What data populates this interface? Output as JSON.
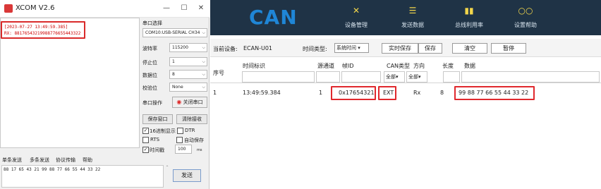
{
  "xcom": {
    "title": "XCOM V2.6",
    "controls": {
      "minimize": "—",
      "maximize": "☐",
      "close": "✕"
    },
    "receive_lines": [
      "[2023-07-27 13:49:59.385]",
      "RX: 88176543219988776655443322"
    ],
    "port_select_label": "串口选择",
    "port_value": "COM10:USB-SERIAL CH34",
    "baud_label": "波特率",
    "baud_value": "115200",
    "stop_bits_label": "停止位",
    "stop_bits_value": "1",
    "data_bits_label": "数据位",
    "data_bits_value": "8",
    "parity_label": "校验位",
    "parity_value": "None",
    "port_op_label": "串口操作",
    "close_port_button": "关闭串口",
    "save_window_button": "保存窗口",
    "clear_recv_button": "清除接收",
    "hex_display_label": "16进制显示",
    "dtr_label": "DTR",
    "rts_label": "RTS",
    "auto_save_label": "自动保存",
    "timestamp_label": "时间戳",
    "timestamp_value": "100",
    "timestamp_unit": "ms",
    "tabs": [
      "单条发送",
      "多条发送",
      "协议传输",
      "帮助"
    ],
    "send_text": "88 17 65 43 21 99 88 77 66 55 44 33 22",
    "send_button": "发送"
  },
  "can": {
    "logo": "CAN",
    "tools": [
      {
        "icon": "✕",
        "label": "设备管理"
      },
      {
        "icon": "☰",
        "label": "发送数据"
      },
      {
        "icon": "▮▮",
        "label": "总线利用率"
      },
      {
        "icon": "○○",
        "label": "设置帮助"
      }
    ],
    "current_device_label": "当前设备:",
    "current_device_value": "ECAN-U01",
    "time_type_label": "时间类型:",
    "time_type_value": "系统时间",
    "buttons": {
      "realtime_save": "实时保存",
      "save": "保存",
      "clear": "清空",
      "pause": "暂停"
    },
    "columns": {
      "seq": "序号",
      "time": "时间标识",
      "channel": "源通道",
      "frame_id": "帧ID",
      "can_type": "CAN类型",
      "direction": "方向",
      "length": "长度",
      "data": "数据"
    },
    "filters": {
      "can_type_all": "全部",
      "direction_all": "全部"
    },
    "rows": [
      {
        "seq": "1",
        "time": "13:49:59.384",
        "channel": "1",
        "frame_id": "0x17654321",
        "can_type": "EXT",
        "direction": "Rx",
        "length": "8",
        "data": "99 88 77 66 55 44 33 22"
      }
    ]
  }
}
